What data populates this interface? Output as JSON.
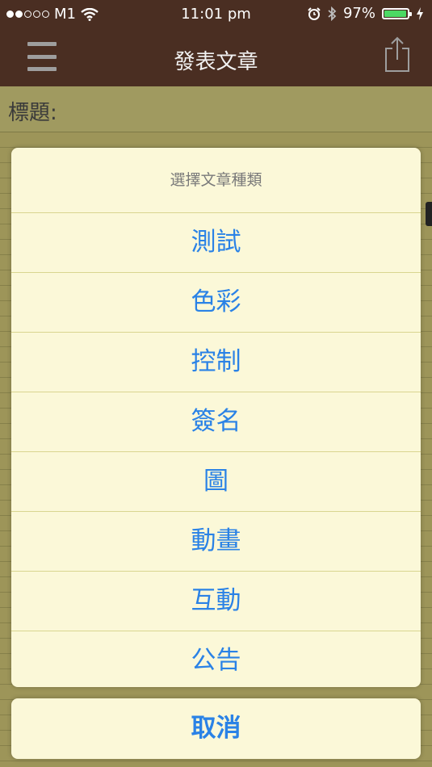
{
  "status_bar": {
    "carrier": "M1",
    "time": "11:01 pm",
    "battery_percent_text": "97%",
    "battery_level": 0.97,
    "signal_bars_filled": 2,
    "signal_bars_total": 5,
    "icons": [
      "wifi-icon",
      "alarm-icon",
      "bluetooth-icon",
      "battery-icon",
      "charging-icon"
    ]
  },
  "nav": {
    "title": "發表文章",
    "left_icon": "hamburger-menu-icon",
    "right_icon": "share-icon"
  },
  "form": {
    "title_label": "標題:"
  },
  "action_sheet": {
    "header": "選擇文章種類",
    "options": [
      "測試",
      "色彩",
      "控制",
      "簽名",
      "圖",
      "動畫",
      "互動",
      "公告"
    ],
    "cancel_label": "取消"
  },
  "colors": {
    "bar_background": "#4a2e22",
    "paper": "#9d9559",
    "sheet_background": "#fbf8d8",
    "action_blue": "#2a82e6",
    "battery_green": "#4cd964"
  }
}
